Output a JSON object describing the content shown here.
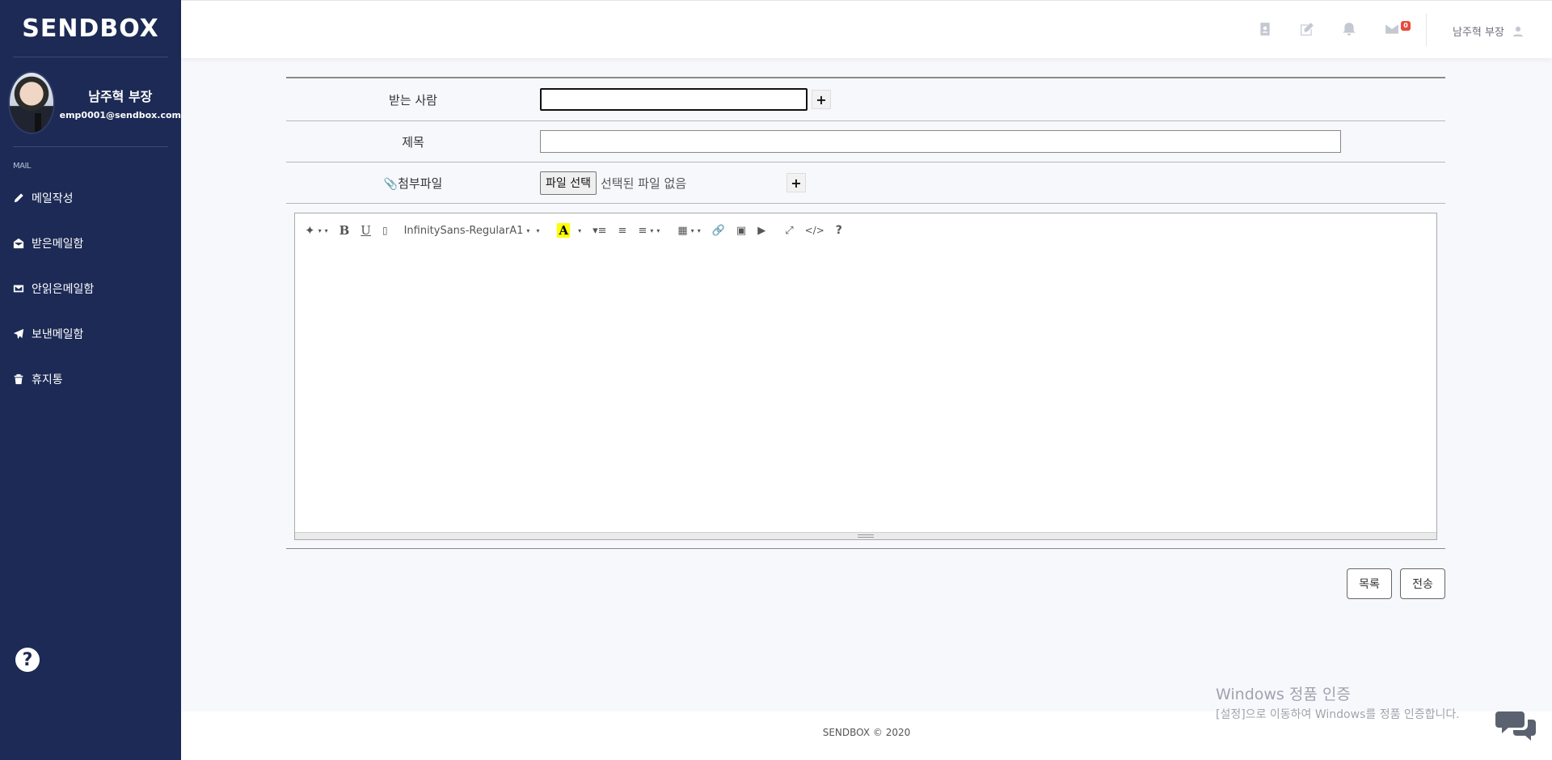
{
  "app": {
    "logo": "SENDBOX"
  },
  "profile": {
    "name": "남주혁 부장",
    "email": "emp0001@sendbox.com"
  },
  "sidebar": {
    "section": "MAIL",
    "items": [
      {
        "label": "메일작성",
        "icon": "pencil-icon"
      },
      {
        "label": "받은메일함",
        "icon": "envelope-open-icon"
      },
      {
        "label": "안읽은메일함",
        "icon": "envelope-icon"
      },
      {
        "label": "보낸메일함",
        "icon": "paper-plane-icon"
      },
      {
        "label": "휴지통",
        "icon": "trash-icon"
      }
    ],
    "help": "?"
  },
  "topbar": {
    "icons": [
      "address-book-icon",
      "edit-icon",
      "bell-icon",
      "mail-icon"
    ],
    "mail_badge": "0",
    "user": "남주혁 부장",
    "colors": {
      "badge": "#e74a3b"
    }
  },
  "form": {
    "to_label": "받는 사람",
    "to_value": "",
    "subject_label": "제목",
    "subject_value": "",
    "attach_label": "첨부파일",
    "file_button": "파일 선택",
    "file_status": "선택된 파일 없음",
    "add": "+"
  },
  "editor": {
    "font_name": "InfinitySans-RegularA1",
    "highlight_letter": "A",
    "bold": "B",
    "underline": "U",
    "codeview": "</>",
    "help": "?",
    "colors": {
      "highlight": "#ffff00"
    }
  },
  "buttons": {
    "list": "목록",
    "send": "전송"
  },
  "footer": {
    "text": "SENDBOX © 2020"
  },
  "watermark": {
    "line1": "Windows 정품 인증",
    "line2": "[설정]으로 이동하여 Windows를 정품 인증합니다."
  },
  "colors": {
    "sidebar": "#1c2a55",
    "background": "#f7f8fc"
  }
}
